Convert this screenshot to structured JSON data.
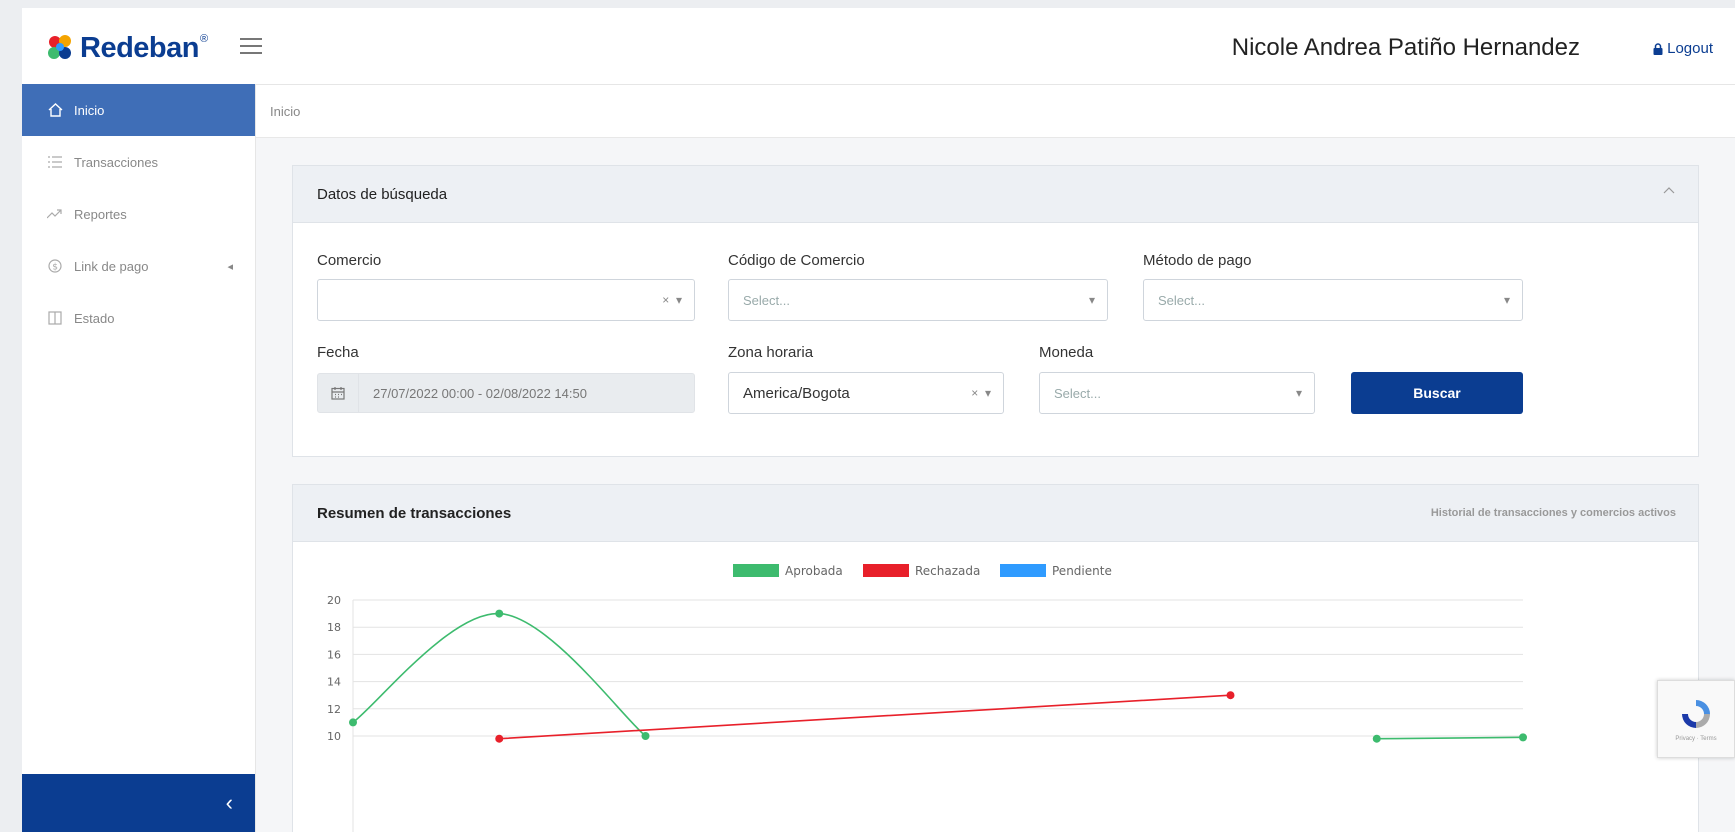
{
  "header": {
    "brand": "Redeban",
    "user_name": "Nicole Andrea Patiño Hernandez",
    "logout_label": "Logout"
  },
  "sidebar": {
    "items": [
      {
        "label": "Inicio",
        "icon": "home-icon"
      },
      {
        "label": "Transacciones",
        "icon": "list-icon"
      },
      {
        "label": "Reportes",
        "icon": "trend-icon"
      },
      {
        "label": "Link de pago",
        "icon": "dollar-circle-icon"
      },
      {
        "label": "Estado",
        "icon": "columns-icon"
      }
    ]
  },
  "breadcrumb": "Inicio",
  "search": {
    "title": "Datos de búsqueda",
    "comercio_label": "Comercio",
    "codigo_label": "Código de Comercio",
    "codigo_placeholder": "Select...",
    "metodo_label": "Método de pago",
    "metodo_placeholder": "Select...",
    "fecha_label": "Fecha",
    "fecha_value": "27/07/2022 00:00 - 02/08/2022 14:50",
    "zona_label": "Zona horaria",
    "zona_value": "America/Bogota",
    "moneda_label": "Moneda",
    "moneda_placeholder": "Select...",
    "buscar_label": "Buscar"
  },
  "summary": {
    "title": "Resumen de transacciones",
    "subtitle": "Historial de transacciones y comercios activos"
  },
  "chart_data": {
    "type": "line",
    "ylim": [
      10,
      20
    ],
    "yticks": [
      10,
      12,
      14,
      16,
      18,
      20
    ],
    "series": [
      {
        "name": "Aprobada",
        "color": "#3dbb6e",
        "points": [
          [
            0,
            11
          ],
          [
            1,
            19
          ],
          [
            2,
            10
          ]
        ],
        "tail": [
          [
            7,
            9.8
          ],
          [
            8,
            9.9
          ]
        ]
      },
      {
        "name": "Rechazada",
        "color": "#e8202a",
        "points": [
          [
            1,
            9.8
          ],
          [
            6,
            13
          ]
        ],
        "tail": []
      },
      {
        "name": "Pendiente",
        "color": "#2f9bff",
        "points": [],
        "tail": []
      }
    ]
  },
  "colors": {
    "brand": "#0b3d91",
    "sidebar_active": "#3f6eb7"
  }
}
